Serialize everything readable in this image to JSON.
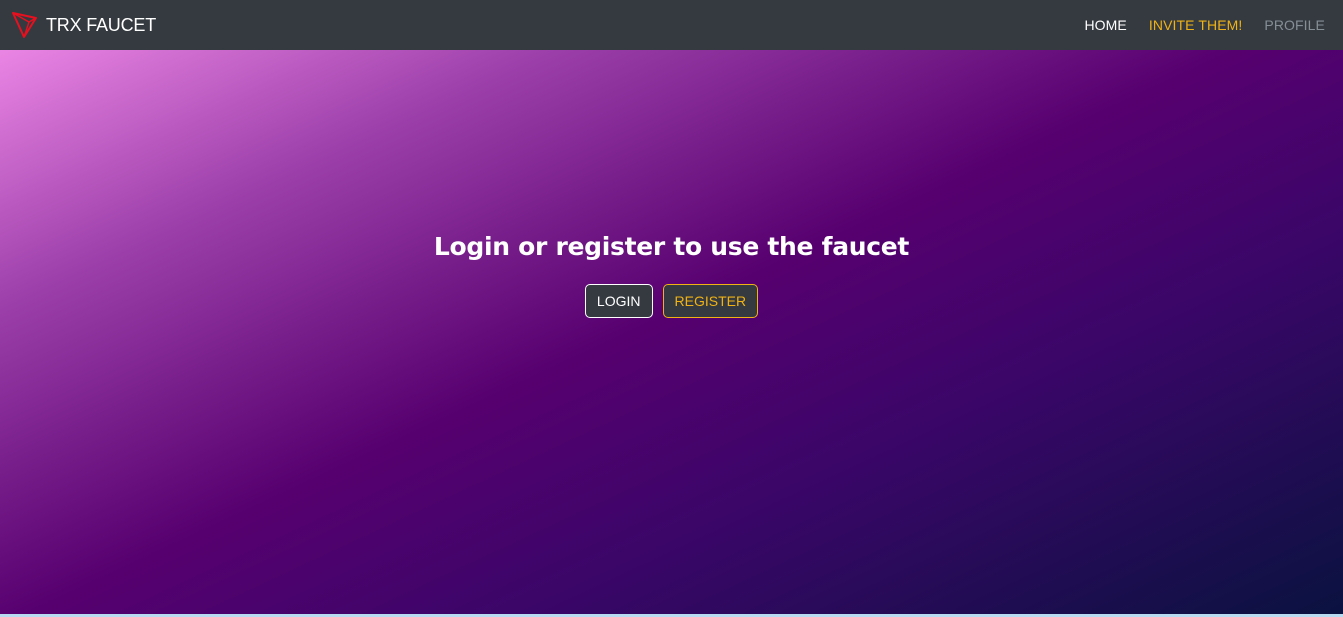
{
  "navbar": {
    "brand": "TRX FAUCET",
    "logo_icon": "tron-logo-icon",
    "links": [
      {
        "label": "HOME",
        "color": "#ffffff"
      },
      {
        "label": "INVITE THEM!",
        "color": "#f0b214"
      },
      {
        "label": "PROFILE",
        "color": "#868e96"
      }
    ]
  },
  "hero": {
    "title": "Login or register to use the faucet",
    "login_label": "LOGIN",
    "register_label": "REGISTER"
  },
  "colors": {
    "navbar_bg": "#343a40",
    "accent": "#f0b214",
    "logo_red": "#e8101e"
  }
}
